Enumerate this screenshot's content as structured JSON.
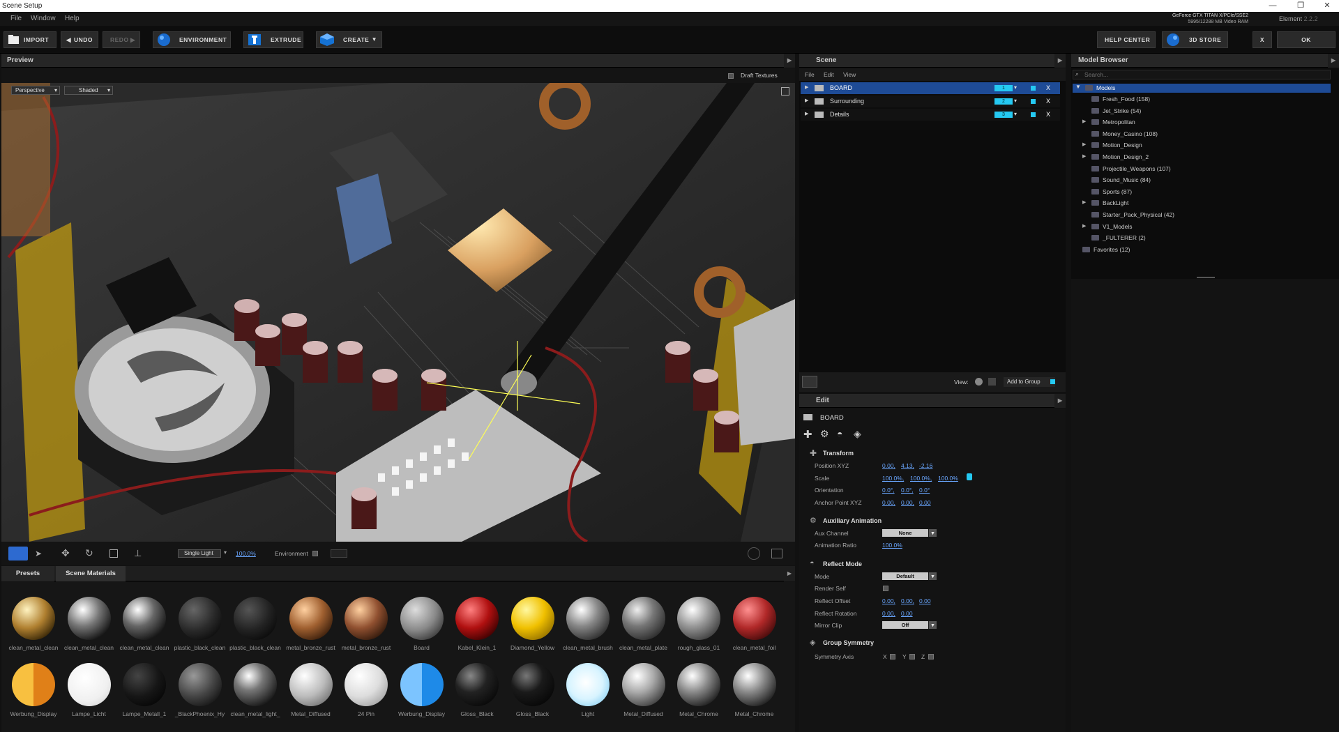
{
  "window": {
    "title": "Scene Setup",
    "minimize": "—",
    "restore": "❐",
    "close": "✕"
  },
  "menu": {
    "file": "File",
    "window": "Window",
    "help": "Help"
  },
  "gpu": {
    "line1": "GeForce GTX TITAN X/PCIe/SSE2",
    "line2": "5995/12288 MB Video RAM"
  },
  "version": {
    "name": "Element",
    "number": "2.2.2"
  },
  "toolbar": {
    "import": "IMPORT",
    "undo": "UNDO",
    "redo": "REDO",
    "environment": "ENVIRONMENT",
    "extrude": "EXTRUDE",
    "create": "CREATE",
    "help_center": "HELP CENTER",
    "store": "3D STORE",
    "cancel": "X",
    "ok": "OK"
  },
  "preview": {
    "title": "Preview",
    "draft_textures": "Draft Textures",
    "camera": "Perspective",
    "shading": "Shaded",
    "light_mode": "Single Light",
    "light_value": "100.0%",
    "environment": "Environment"
  },
  "scene": {
    "title": "Scene",
    "menu_file": "File",
    "menu_edit": "Edit",
    "menu_view": "View",
    "groups": [
      {
        "name": "BOARD",
        "num": "1"
      },
      {
        "name": "Surrounding",
        "num": "2"
      },
      {
        "name": "Details",
        "num": "3"
      }
    ],
    "view_label": "View:",
    "add_to_group": "Add to Group"
  },
  "model_browser": {
    "title": "Model Browser",
    "search_placeholder": "Search...",
    "root": "Models",
    "items": [
      "Fresh_Food (158)",
      "Jet_Strike (54)",
      "Metropolitan",
      "Money_Casino (108)",
      "Motion_Design",
      "Motion_Design_2",
      "Projectile_Weapons (107)",
      "Sound_Music (84)",
      "Sports (87)",
      "BackLight",
      "Starter_Pack_Physical (42)",
      "V1_Models",
      "_FULTERER (2)"
    ],
    "favorites": "Favorites (12)"
  },
  "edit": {
    "title": "Edit",
    "object": "BOARD",
    "transform": "Transform",
    "position_label": "Position XYZ",
    "position": [
      "0.00,",
      "4.13,",
      "-2.16"
    ],
    "scale_label": "Scale",
    "scale": [
      "100.0%,",
      "100.0%,",
      "100.0%"
    ],
    "orientation_label": "Orientation",
    "orientation": [
      "0.0°,",
      "0.0°,",
      "0.0°"
    ],
    "anchor_label": "Anchor Point XYZ",
    "anchor": [
      "0.00,",
      "0.00,",
      "0.00"
    ],
    "aux": "Auxiliary Animation",
    "aux_channel_label": "Aux Channel",
    "aux_channel": "None",
    "anim_ratio_label": "Animation Ratio",
    "anim_ratio": "100.0%",
    "reflect": "Reflect Mode",
    "mode_label": "Mode",
    "mode": "Default",
    "render_self_label": "Render Self",
    "reflect_offset_label": "Reflect Offset",
    "reflect_offset": [
      "0.00,",
      "0.00,",
      "0.00"
    ],
    "reflect_rotation_label": "Reflect Rotation",
    "reflect_rotation": [
      "0.00,",
      "0.00"
    ],
    "mirror_clip_label": "Mirror Clip",
    "mirror_clip": "Off",
    "symmetry": "Group Symmetry",
    "symmetry_axis_label": "Symmetry Axis",
    "axes": [
      "X",
      "Y",
      "Z"
    ]
  },
  "materials": {
    "tab_presets": "Presets",
    "tab_scene": "Scene Materials",
    "row1": [
      "clean_metal_clean",
      "clean_metal_clean",
      "clean_metal_clean",
      "plastic_black_clean",
      "plastic_black_clean",
      "metal_bronze_rust",
      "metal_bronze_rust",
      "Board",
      "Kabel_Klein_1",
      "Diamond_Yellow",
      "clean_metal_brush",
      "clean_metal_plate",
      "rough_glass_01",
      "clean_metal_foil"
    ],
    "row2": [
      "Werbung_Display",
      "Lampe_Licht",
      "Lampe_Metall_1",
      "_BlackPhoenix_Hy",
      "clean_metal_light_",
      "Metal_Diffused",
      "24 Pin",
      "Werbung_Display",
      "Gloss_Black",
      "Gloss_Black",
      "Light",
      "Metal_Diffused",
      "Metal_Chrome",
      "Metal_Chrome"
    ]
  }
}
